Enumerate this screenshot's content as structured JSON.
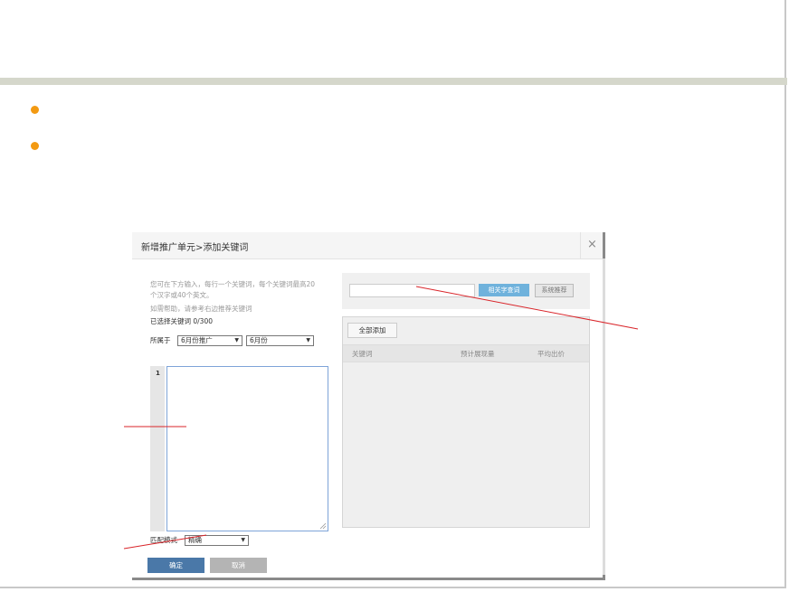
{
  "dialog": {
    "title": "新增推广单元>添加关键词",
    "close_glyph": "×",
    "help_lines": [
      "您可在下方输入，每行一个关键词，每个关键词最高20",
      "个汉字或40个英文。",
      "如需帮助，请参考右边推荐关键词"
    ],
    "selected_count": "已选择关键词 0/300",
    "belongs_label": "所属于",
    "campaign_select": "6月份推广",
    "unit_select": "6月份",
    "editor_line_number": "1",
    "match_mode_label": "匹配模式",
    "match_mode_value": "精确",
    "ok_label": "确定",
    "cancel_label": "取消",
    "related_search_label": "相关字查词",
    "system_recommend_label": "系统推荐",
    "add_all_label": "全部添加",
    "columns": [
      "关键词",
      "预计展现量",
      "平均出价"
    ]
  },
  "colors": {
    "bullet": "#f39a12",
    "band": "#d5d7cb",
    "primary_button": "#4a78a8",
    "search_button": "#6fb2dc",
    "annotation_line": "#d9252a"
  },
  "icons": [
    "close-icon",
    "dropdown-arrow-icon",
    "bullet-icon"
  ]
}
